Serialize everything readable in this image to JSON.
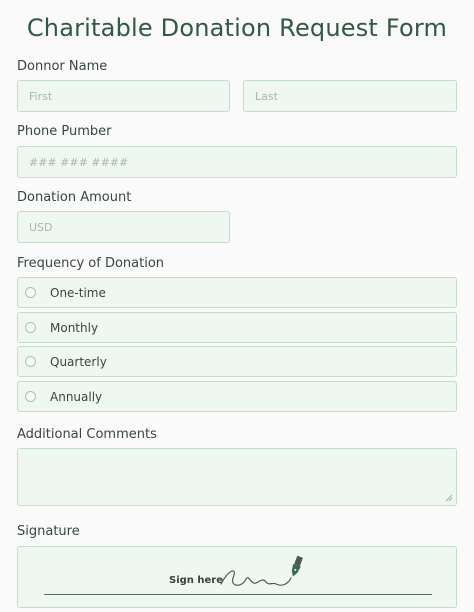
{
  "form": {
    "title": "Charitable Donation Request Form",
    "name_label": "Donnor Name",
    "first_placeholder": "First",
    "last_placeholder": "Last",
    "phone_label": "Phone Pumber",
    "phone_placeholder": "### ### ####",
    "amount_label": "Donation Amount",
    "amount_placeholder": "USD",
    "frequency_label": "Frequency of Donation",
    "frequency_options": [
      "One-time",
      "Monthly",
      "Quarterly",
      "Annually"
    ],
    "comments_label": "Additional Comments",
    "signature_label": "Signature",
    "signature_hint": "Sign here"
  },
  "colors": {
    "title": "#2f5a44",
    "field_bg": "#eff7f1",
    "field_border": "#c3dccb"
  },
  "icons": {
    "signature": "pen-signature-icon",
    "radio": "radio-circle-icon",
    "resize": "resize-grip-icon"
  }
}
